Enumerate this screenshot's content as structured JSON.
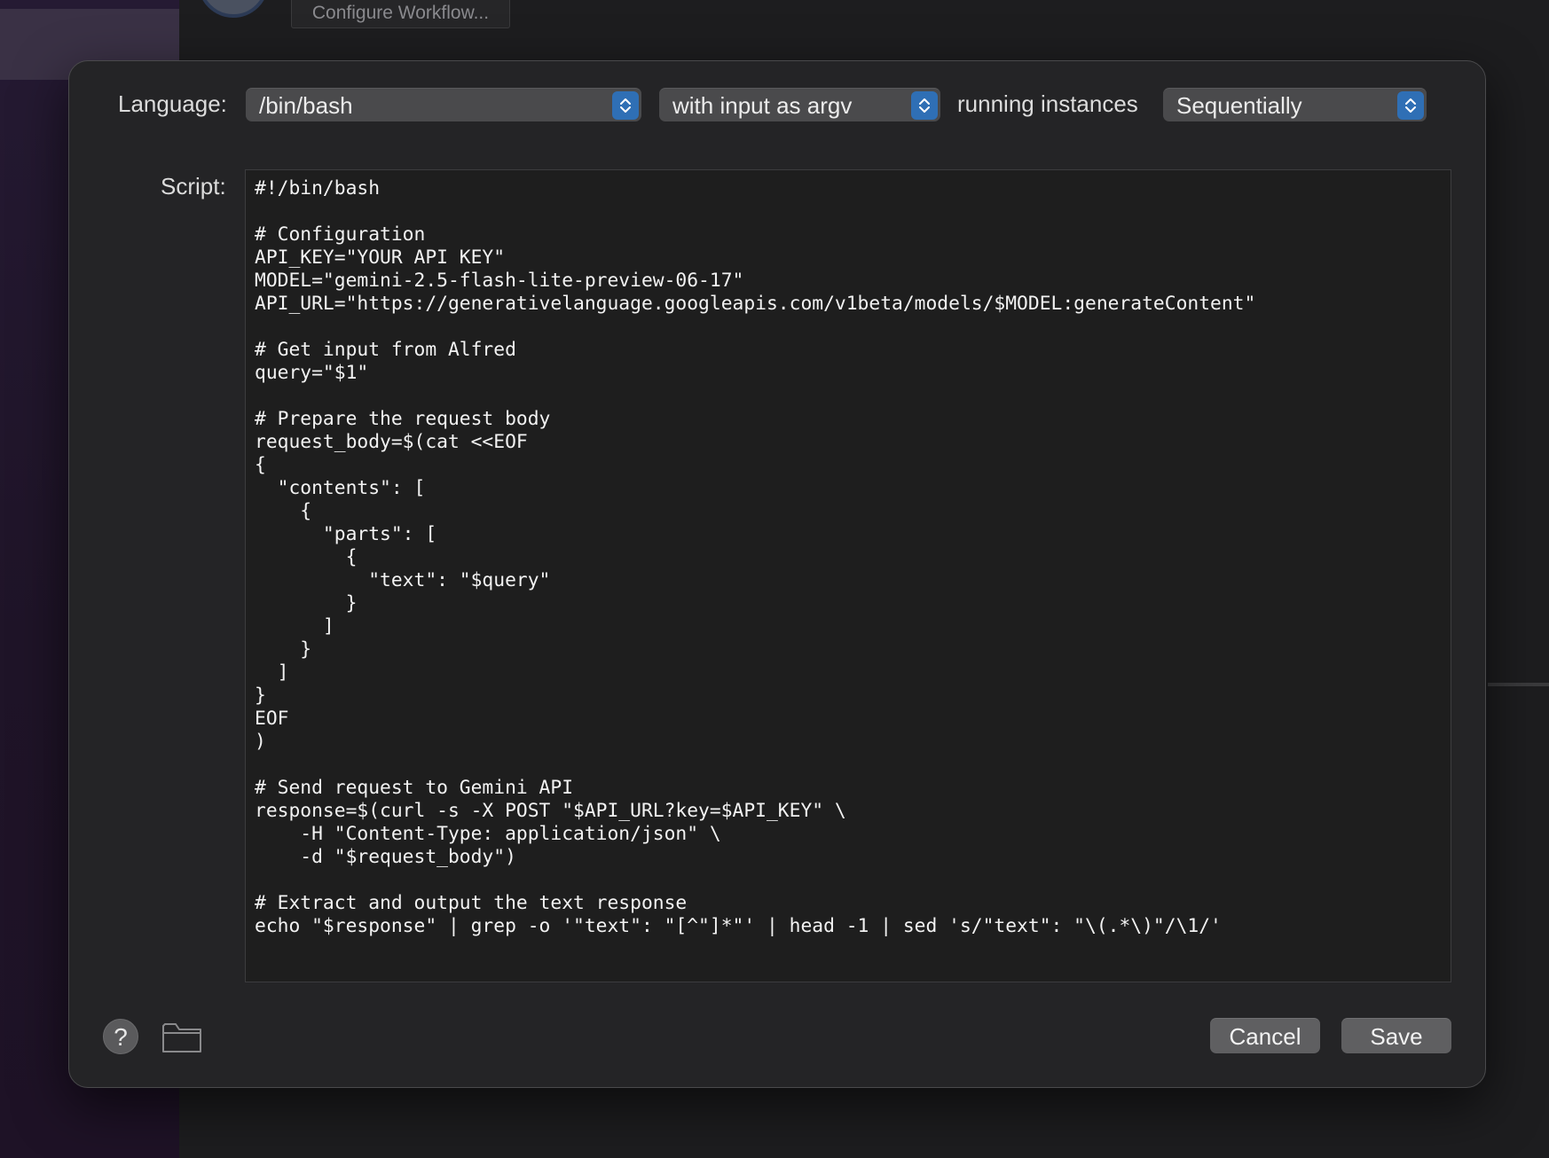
{
  "background": {
    "configure_workflow_label": "Configure Workflow..."
  },
  "dialog": {
    "language_label": "Language:",
    "language_value": "/bin/bash",
    "input_mode_value": "with input as argv",
    "running_instances_label": "running instances",
    "running_instances_value": "Sequentially",
    "script_label": "Script:",
    "script": "#!/bin/bash\n\n# Configuration\nAPI_KEY=\"YOUR API KEY\"\nMODEL=\"gemini-2.5-flash-lite-preview-06-17\"\nAPI_URL=\"https://generativelanguage.googleapis.com/v1beta/models/$MODEL:generateContent\"\n\n# Get input from Alfred\nquery=\"$1\"\n\n# Prepare the request body\nrequest_body=$(cat <<EOF\n{\n  \"contents\": [\n    {\n      \"parts\": [\n        {\n          \"text\": \"$query\"\n        }\n      ]\n    }\n  ]\n}\nEOF\n)\n\n# Send request to Gemini API\nresponse=$(curl -s -X POST \"$API_URL?key=$API_KEY\" \\\n    -H \"Content-Type: application/json\" \\\n    -d \"$request_body\")\n\n# Extract and output the text response\necho \"$response\" | grep -o '\"text\": \"[^\"]*\"' | head -1 | sed 's/\"text\": \"\\(.*\\)\"/\\1/'",
    "help_label": "?",
    "cancel_label": "Cancel",
    "save_label": "Save"
  },
  "icons": {
    "help": "question-mark-icon",
    "folder": "folder-icon",
    "stepper": "up-down-chevron-icon"
  },
  "colors": {
    "accent": "#2f6fb5",
    "dialog_bg": "#242426",
    "editor_bg": "#1e1e1e"
  }
}
